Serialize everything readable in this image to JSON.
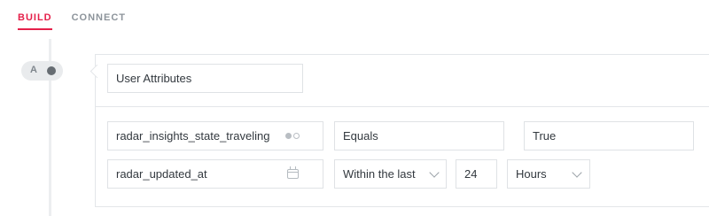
{
  "tabs": [
    {
      "label": "BUILD",
      "active": true
    },
    {
      "label": "CONNECT",
      "active": false
    }
  ],
  "step": {
    "letter": "A"
  },
  "filter_type": {
    "value": "User Attributes"
  },
  "conditions": [
    {
      "attribute": "radar_insights_state_traveling",
      "attribute_icon": "toggle-icon",
      "operator": "Equals",
      "value": "True"
    },
    {
      "attribute": "radar_updated_at",
      "attribute_icon": "calendar-icon",
      "operator": "Within the last",
      "amount": "24",
      "unit": "Hours"
    }
  ],
  "colors": {
    "accent": "#e5204a",
    "muted_text": "#8d949b",
    "border": "#dfe2e5",
    "step_dot": "#666c72"
  }
}
